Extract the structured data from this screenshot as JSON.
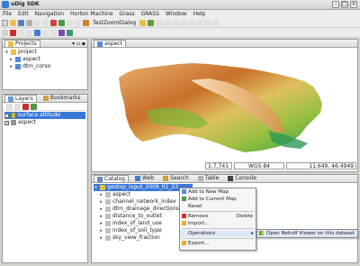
{
  "window": {
    "title": "uDig SDK"
  },
  "menu": [
    "File",
    "Edit",
    "Navigation",
    "Horton Machine",
    "Grass",
    "GRASS",
    "Window",
    "Help"
  ],
  "toolbar": {
    "test_zoom_dialog": "TestZoomDialog"
  },
  "projects": {
    "tab_label": "Projects",
    "items": [
      {
        "label": "project",
        "level": 0,
        "expanded": true
      },
      {
        "label": "aspect",
        "level": 1,
        "expanded": false
      },
      {
        "label": "dtm_corso",
        "level": 1,
        "expanded": false
      }
    ]
  },
  "layers": {
    "tabs": [
      "Layers",
      "Bookmarks"
    ],
    "items": [
      {
        "label": "surface altitude",
        "checked": true,
        "selected": true
      },
      {
        "label": "aspect",
        "checked": true,
        "selected": false
      }
    ]
  },
  "map": {
    "tab_label": "aspect"
  },
  "statusbar": {
    "scale": "1:7,741",
    "crs": "WGS 84",
    "coords": "11.649, 46.4949"
  },
  "bottom": {
    "tabs": [
      "Catalog",
      "Web",
      "Search",
      "Table",
      "Console"
    ],
    "items": [
      {
        "label": "geotop_input_2009_01_23",
        "selected": true
      },
      {
        "label": "aspect"
      },
      {
        "label": "channel_network_index"
      },
      {
        "label": "dtm_drainage_directions"
      },
      {
        "label": "distance_to_outlet"
      },
      {
        "label": "index_of_land_use"
      },
      {
        "label": "index_of_soil_type"
      },
      {
        "label": "sky_view_fraction"
      }
    ]
  },
  "context_menu": {
    "items": [
      {
        "label": "Add to New Map",
        "shortcut": ""
      },
      {
        "label": "Add to Current Map",
        "shortcut": ""
      },
      {
        "label": "Reset",
        "shortcut": ""
      },
      {
        "label": "Remove",
        "shortcut": "Delete"
      },
      {
        "label": "Import...",
        "shortcut": ""
      },
      {
        "label": "Operations",
        "shortcut": ""
      },
      {
        "label": "Export...",
        "shortcut": ""
      }
    ],
    "submenu": {
      "label": "Open Netcdf Viewer on this dataset"
    }
  },
  "colors": {
    "selection": "#3b78d8",
    "menu_highlight": "#dfe8f6"
  }
}
